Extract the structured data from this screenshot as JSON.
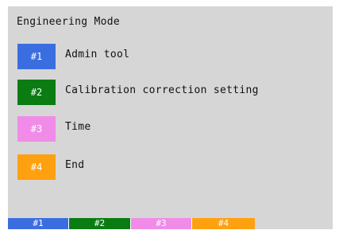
{
  "title": "Engineering Mode",
  "colors": {
    "screen_bg": "#d6d6d6",
    "key1": "#3a6ee0",
    "key2": "#0a7c12",
    "key3": "#f08ce8",
    "key4": "#ffa010"
  },
  "menu": [
    {
      "num": "#1",
      "label": "Admin tool"
    },
    {
      "num": "#2",
      "label": "Calibration correction setting"
    },
    {
      "num": "#3",
      "label": "Time"
    },
    {
      "num": "#4",
      "label": "End"
    }
  ],
  "function_keys": [
    "#1",
    "#2",
    "#3",
    "#4"
  ]
}
